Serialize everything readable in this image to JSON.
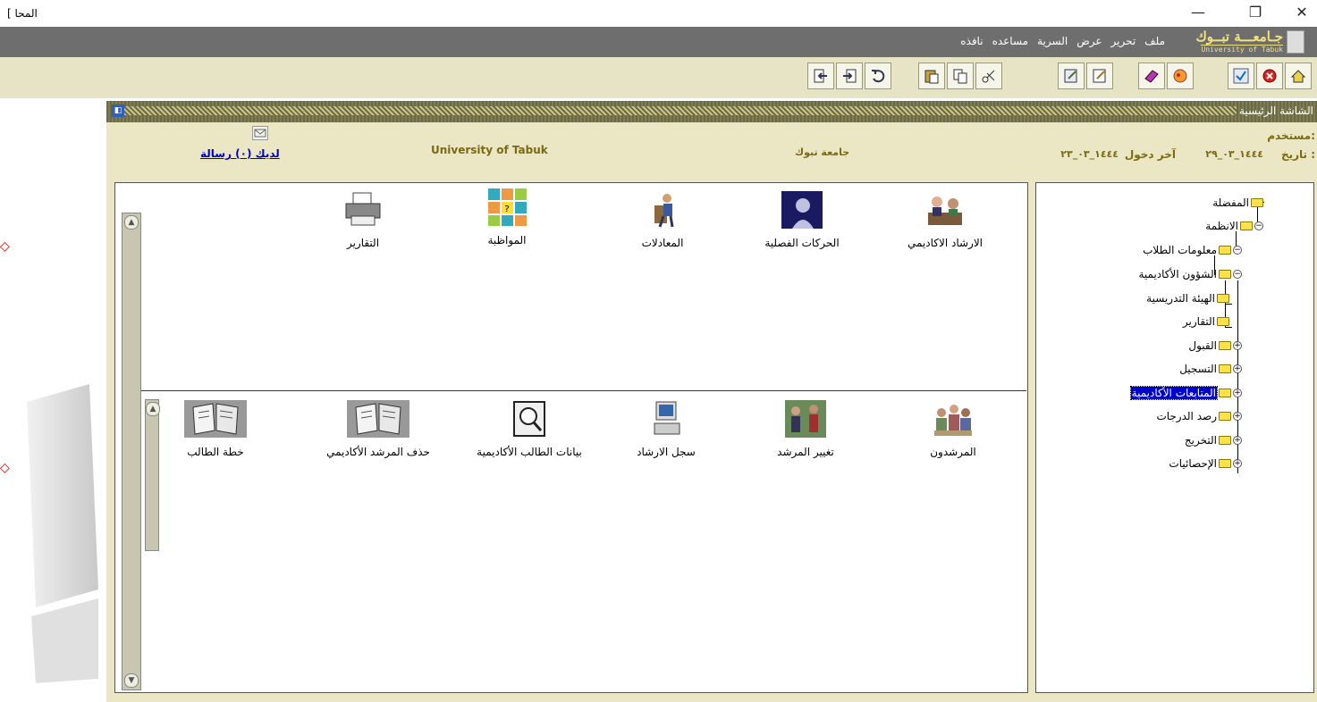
{
  "window": {
    "title": "[ المحا",
    "minimize_glyph": "—",
    "restore_glyph": "❐",
    "close_glyph": "✕"
  },
  "menu": {
    "items": [
      "ملف",
      "تحرير",
      "عرض",
      "السرية",
      "مساعده",
      "نافذه"
    ],
    "logo_ar": "جـامعـــة تبــوك",
    "logo_en": "University of Tabuk"
  },
  "toolbar": {
    "buttons": [
      "home-icon",
      "cancel-icon",
      "check-icon",
      "image-icon",
      "book-icon",
      "edit-icon",
      "edit-alt-icon",
      "cut-icon",
      "copy-icon",
      "paste-icon",
      "undo-icon",
      "exit-icon",
      "enter-icon"
    ]
  },
  "header": {
    "title": "الشاشة الرئيسية"
  },
  "info": {
    "user_label": "مستخدم:",
    "date_label": "تاريخ :",
    "date_value": "١٤٤٤_٠٣_٢٩",
    "last_login_label": "آخر دخول",
    "last_login_value": "١٤٤٤_٠٣_٢٣",
    "university_ar": "جامعة تبوك",
    "university_en": "University of Tabuk",
    "messages": "لديك (٠) رسالة"
  },
  "tiles_top": [
    {
      "label": "الارشاد الاكاديمي",
      "icon": "advising-icon"
    },
    {
      "label": "الحركات الفصلية",
      "icon": "silhouette-icon"
    },
    {
      "label": "المعادلات",
      "icon": "worker-icon"
    },
    {
      "label": "المواظبة",
      "icon": "faces-grid-icon"
    },
    {
      "label": "التقارير",
      "icon": "printer-icon"
    }
  ],
  "tiles_bottom": [
    {
      "label": "المرشدون",
      "icon": "group-icon"
    },
    {
      "label": "تغيير المرشد",
      "icon": "people-icon"
    },
    {
      "label": "سجل الارشاد",
      "icon": "computer-icon"
    },
    {
      "label": "بيانات الطالب الأكاديمية",
      "icon": "magnifier-icon"
    },
    {
      "label": "حذف المرشد الأكاديمي",
      "icon": "documents-icon"
    },
    {
      "label": "خطة الطالب",
      "icon": "documents-icon"
    }
  ],
  "tree": [
    {
      "label": "المفضلة",
      "level": 0
    },
    {
      "label": "الانظمة",
      "level": 0
    },
    {
      "label": "معلومات الطلاب",
      "level": 1
    },
    {
      "label": "الشؤون الأكاديمية",
      "level": 2
    },
    {
      "label": "الهيئة التدريسية",
      "level": 3
    },
    {
      "label": "التقارير",
      "level": 3
    },
    {
      "label": "القبول",
      "level": 3
    },
    {
      "label": "التسجيل",
      "level": 3
    },
    {
      "label": "المتابعات الأكاديمية",
      "level": 3,
      "selected": true
    },
    {
      "label": "رصد الدرجات",
      "level": 3
    },
    {
      "label": "التخريج",
      "level": 3
    },
    {
      "label": "الإحصائيات",
      "level": 3
    }
  ]
}
